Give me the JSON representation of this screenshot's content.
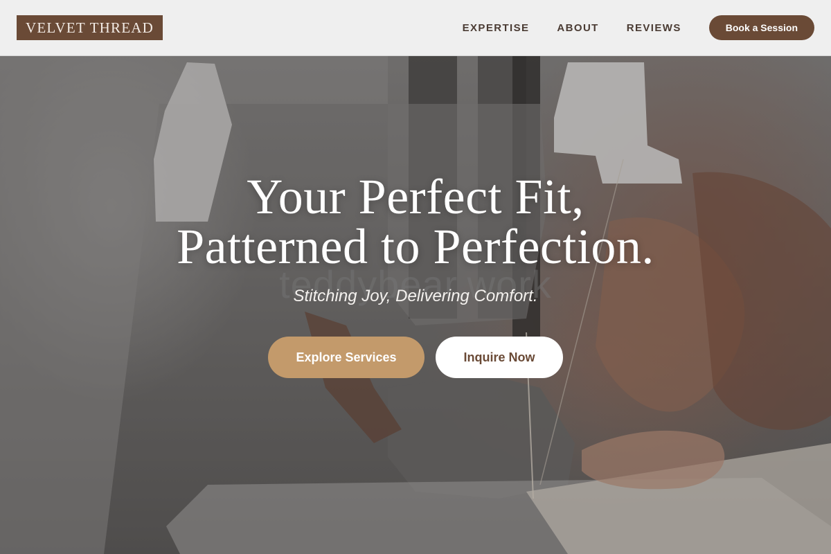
{
  "header": {
    "logo_text": "VELVET THREAD",
    "nav": [
      {
        "label": "EXPERTISE"
      },
      {
        "label": "ABOUT"
      },
      {
        "label": "REVIEWS"
      }
    ],
    "cta_label": "Book a Session"
  },
  "hero": {
    "title_line1": "Your Perfect Fit,",
    "title_line2": "Patterned to Perfection.",
    "watermark": "teddybear.work",
    "subtitle": "Stitching Joy, Delivering Comfort.",
    "primary_button": "Explore Services",
    "secondary_button": "Inquire Now",
    "background_image": "sewing-machine-photo"
  },
  "colors": {
    "brand_brown": "#6a4a36",
    "accent_tan": "#c39a6b",
    "header_bg": "#efefef",
    "white": "#ffffff"
  }
}
